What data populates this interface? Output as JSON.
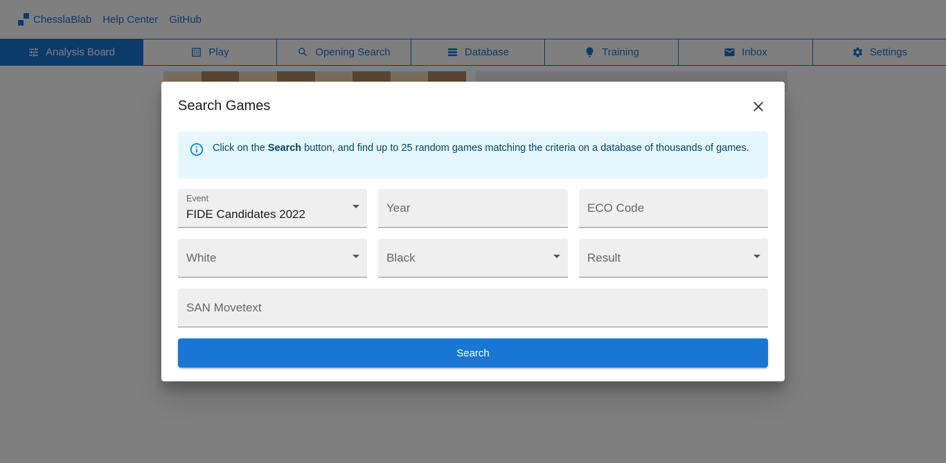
{
  "header": {
    "brand": "ChesslaBlab",
    "links": [
      "Help Center",
      "GitHub"
    ]
  },
  "nav": {
    "items": [
      {
        "label": "Analysis Board",
        "icon": "tune-icon",
        "active": true
      },
      {
        "label": "Play",
        "icon": "grid-icon"
      },
      {
        "label": "Opening Search",
        "icon": "search-icon"
      },
      {
        "label": "Database",
        "icon": "database-icon"
      },
      {
        "label": "Training",
        "icon": "lightbulb-icon"
      },
      {
        "label": "Inbox",
        "icon": "mail-icon"
      },
      {
        "label": "Settings",
        "icon": "gear-icon"
      }
    ]
  },
  "dialog": {
    "title": "Search Games",
    "alert": {
      "prefix": "Click on the ",
      "bold": "Search",
      "suffix": " button, and find up to 25 random games matching the criteria on a database of thousands of games."
    },
    "fields": {
      "event": {
        "label": "Event",
        "value": "FIDE Candidates 2022"
      },
      "year": {
        "placeholder": "Year"
      },
      "eco": {
        "placeholder": "ECO Code"
      },
      "white": {
        "placeholder": "White"
      },
      "black": {
        "placeholder": "Black"
      },
      "result": {
        "placeholder": "Result"
      },
      "movetext": {
        "placeholder": "SAN Movetext"
      }
    },
    "search_label": "Search"
  },
  "colors": {
    "primary": "#1976d2",
    "alert_bg": "#e5f6fd",
    "alert_text": "#014361"
  }
}
